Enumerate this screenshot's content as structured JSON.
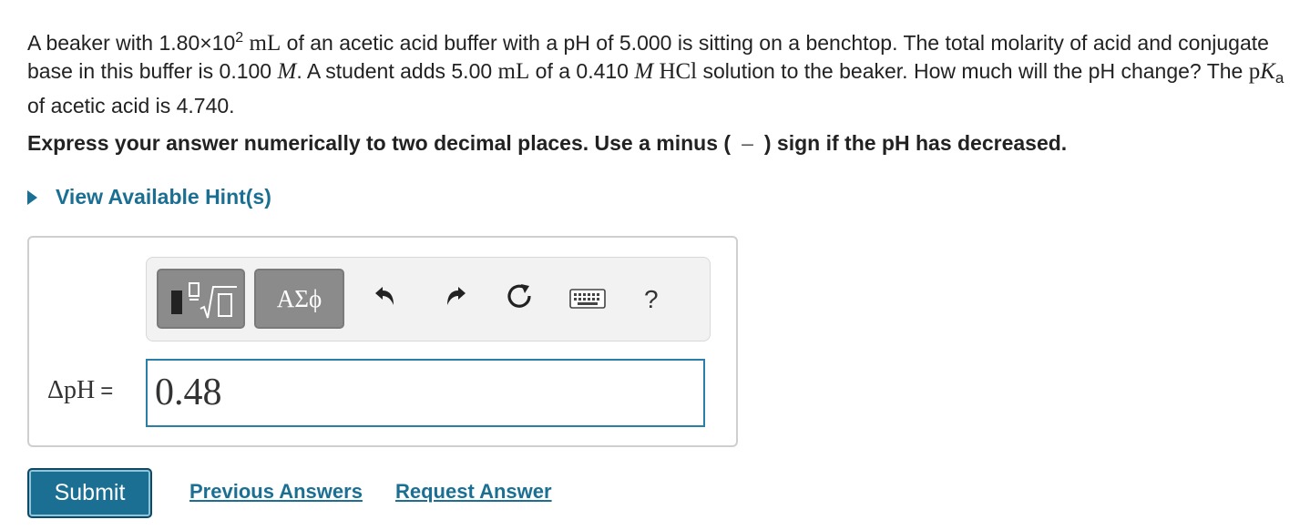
{
  "question": {
    "p1": "A beaker with 1.80×10",
    "exp": "2",
    "unit_ml": "mL",
    "p2": " of an acetic acid buffer with a pH of 5.000 is sitting on a benchtop. The total molarity of acid and conjugate base in this buffer is 0.100 ",
    "M": "M",
    "p3": ".  A student adds 5.00 ",
    "unit_ml2": "mL",
    "p4": " of a 0.410 ",
    "M2": "M",
    "hcl": "HCl",
    "p5": " solution to the beaker. How much will the pH change? The ",
    "pK": "pK",
    "a": "a",
    "p6": " of acetic acid is 4.740."
  },
  "instruction": {
    "before": "Express your answer numerically to two decimal places. Use a minus (",
    "minus": "–",
    "after": ") sign if the pH has decreased."
  },
  "hint_label": "View Available Hint(s)",
  "toolbar": {
    "greek_label": "ΑΣϕ",
    "help_label": "?",
    "icons": [
      "templates-icon",
      "greek-letters-icon",
      "undo-icon",
      "redo-icon",
      "reset-icon",
      "keyboard-icon",
      "help-icon"
    ]
  },
  "answer": {
    "label": "ΔpH",
    "equals": "=",
    "value": "0.48"
  },
  "actions": {
    "submit": "Submit",
    "previous": "Previous Answers",
    "request": "Request Answer"
  },
  "colors": {
    "accent": "#1a6f93",
    "input_border": "#2a7ea8",
    "toolbar_button": "#8b8b8b"
  }
}
